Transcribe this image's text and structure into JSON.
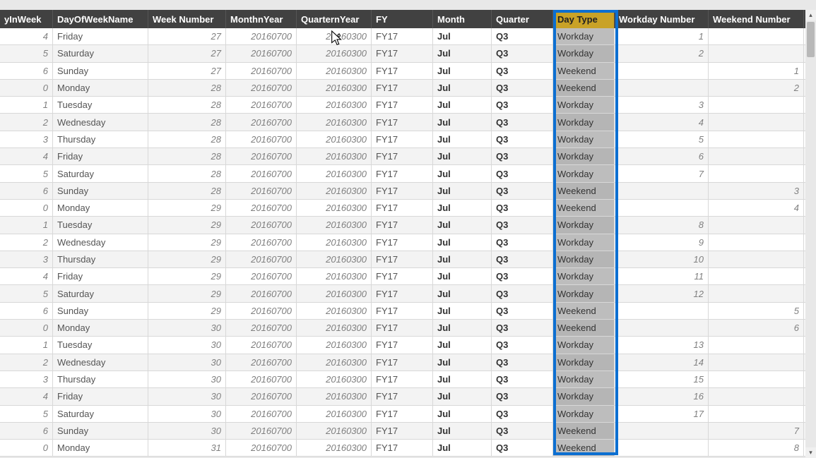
{
  "columns": [
    {
      "key": "dayInWeek",
      "label": "yInWeek"
    },
    {
      "key": "dayOfWeekName",
      "label": "DayOfWeekName"
    },
    {
      "key": "weekNumber",
      "label": "Week Number"
    },
    {
      "key": "monthnYear",
      "label": "MonthnYear"
    },
    {
      "key": "quarternYear",
      "label": "QuarternYear"
    },
    {
      "key": "fy",
      "label": "FY"
    },
    {
      "key": "month",
      "label": "Month"
    },
    {
      "key": "quarter",
      "label": "Quarter"
    },
    {
      "key": "dayType",
      "label": "Day Type"
    },
    {
      "key": "workdayNumber",
      "label": "Workday Number"
    },
    {
      "key": "weekendNumber",
      "label": "Weekend Number"
    }
  ],
  "highlighted_column_index": 8,
  "rows": [
    {
      "dayInWeek": "4",
      "dayOfWeekName": "Friday",
      "weekNumber": "27",
      "monthnYear": "20160700",
      "quarternYear": "20160300",
      "fy": "FY17",
      "month": "Jul",
      "quarter": "Q3",
      "dayType": "Workday",
      "workdayNumber": "1",
      "weekendNumber": ""
    },
    {
      "dayInWeek": "5",
      "dayOfWeekName": "Saturday",
      "weekNumber": "27",
      "monthnYear": "20160700",
      "quarternYear": "20160300",
      "fy": "FY17",
      "month": "Jul",
      "quarter": "Q3",
      "dayType": "Workday",
      "workdayNumber": "2",
      "weekendNumber": ""
    },
    {
      "dayInWeek": "6",
      "dayOfWeekName": "Sunday",
      "weekNumber": "27",
      "monthnYear": "20160700",
      "quarternYear": "20160300",
      "fy": "FY17",
      "month": "Jul",
      "quarter": "Q3",
      "dayType": "Weekend",
      "workdayNumber": "",
      "weekendNumber": "1"
    },
    {
      "dayInWeek": "0",
      "dayOfWeekName": "Monday",
      "weekNumber": "28",
      "monthnYear": "20160700",
      "quarternYear": "20160300",
      "fy": "FY17",
      "month": "Jul",
      "quarter": "Q3",
      "dayType": "Weekend",
      "workdayNumber": "",
      "weekendNumber": "2"
    },
    {
      "dayInWeek": "1",
      "dayOfWeekName": "Tuesday",
      "weekNumber": "28",
      "monthnYear": "20160700",
      "quarternYear": "20160300",
      "fy": "FY17",
      "month": "Jul",
      "quarter": "Q3",
      "dayType": "Workday",
      "workdayNumber": "3",
      "weekendNumber": ""
    },
    {
      "dayInWeek": "2",
      "dayOfWeekName": "Wednesday",
      "weekNumber": "28",
      "monthnYear": "20160700",
      "quarternYear": "20160300",
      "fy": "FY17",
      "month": "Jul",
      "quarter": "Q3",
      "dayType": "Workday",
      "workdayNumber": "4",
      "weekendNumber": ""
    },
    {
      "dayInWeek": "3",
      "dayOfWeekName": "Thursday",
      "weekNumber": "28",
      "monthnYear": "20160700",
      "quarternYear": "20160300",
      "fy": "FY17",
      "month": "Jul",
      "quarter": "Q3",
      "dayType": "Workday",
      "workdayNumber": "5",
      "weekendNumber": ""
    },
    {
      "dayInWeek": "4",
      "dayOfWeekName": "Friday",
      "weekNumber": "28",
      "monthnYear": "20160700",
      "quarternYear": "20160300",
      "fy": "FY17",
      "month": "Jul",
      "quarter": "Q3",
      "dayType": "Workday",
      "workdayNumber": "6",
      "weekendNumber": ""
    },
    {
      "dayInWeek": "5",
      "dayOfWeekName": "Saturday",
      "weekNumber": "28",
      "monthnYear": "20160700",
      "quarternYear": "20160300",
      "fy": "FY17",
      "month": "Jul",
      "quarter": "Q3",
      "dayType": "Workday",
      "workdayNumber": "7",
      "weekendNumber": ""
    },
    {
      "dayInWeek": "6",
      "dayOfWeekName": "Sunday",
      "weekNumber": "28",
      "monthnYear": "20160700",
      "quarternYear": "20160300",
      "fy": "FY17",
      "month": "Jul",
      "quarter": "Q3",
      "dayType": "Weekend",
      "workdayNumber": "",
      "weekendNumber": "3"
    },
    {
      "dayInWeek": "0",
      "dayOfWeekName": "Monday",
      "weekNumber": "29",
      "monthnYear": "20160700",
      "quarternYear": "20160300",
      "fy": "FY17",
      "month": "Jul",
      "quarter": "Q3",
      "dayType": "Weekend",
      "workdayNumber": "",
      "weekendNumber": "4"
    },
    {
      "dayInWeek": "1",
      "dayOfWeekName": "Tuesday",
      "weekNumber": "29",
      "monthnYear": "20160700",
      "quarternYear": "20160300",
      "fy": "FY17",
      "month": "Jul",
      "quarter": "Q3",
      "dayType": "Workday",
      "workdayNumber": "8",
      "weekendNumber": ""
    },
    {
      "dayInWeek": "2",
      "dayOfWeekName": "Wednesday",
      "weekNumber": "29",
      "monthnYear": "20160700",
      "quarternYear": "20160300",
      "fy": "FY17",
      "month": "Jul",
      "quarter": "Q3",
      "dayType": "Workday",
      "workdayNumber": "9",
      "weekendNumber": ""
    },
    {
      "dayInWeek": "3",
      "dayOfWeekName": "Thursday",
      "weekNumber": "29",
      "monthnYear": "20160700",
      "quarternYear": "20160300",
      "fy": "FY17",
      "month": "Jul",
      "quarter": "Q3",
      "dayType": "Workday",
      "workdayNumber": "10",
      "weekendNumber": ""
    },
    {
      "dayInWeek": "4",
      "dayOfWeekName": "Friday",
      "weekNumber": "29",
      "monthnYear": "20160700",
      "quarternYear": "20160300",
      "fy": "FY17",
      "month": "Jul",
      "quarter": "Q3",
      "dayType": "Workday",
      "workdayNumber": "11",
      "weekendNumber": ""
    },
    {
      "dayInWeek": "5",
      "dayOfWeekName": "Saturday",
      "weekNumber": "29",
      "monthnYear": "20160700",
      "quarternYear": "20160300",
      "fy": "FY17",
      "month": "Jul",
      "quarter": "Q3",
      "dayType": "Workday",
      "workdayNumber": "12",
      "weekendNumber": ""
    },
    {
      "dayInWeek": "6",
      "dayOfWeekName": "Sunday",
      "weekNumber": "29",
      "monthnYear": "20160700",
      "quarternYear": "20160300",
      "fy": "FY17",
      "month": "Jul",
      "quarter": "Q3",
      "dayType": "Weekend",
      "workdayNumber": "",
      "weekendNumber": "5"
    },
    {
      "dayInWeek": "0",
      "dayOfWeekName": "Monday",
      "weekNumber": "30",
      "monthnYear": "20160700",
      "quarternYear": "20160300",
      "fy": "FY17",
      "month": "Jul",
      "quarter": "Q3",
      "dayType": "Weekend",
      "workdayNumber": "",
      "weekendNumber": "6"
    },
    {
      "dayInWeek": "1",
      "dayOfWeekName": "Tuesday",
      "weekNumber": "30",
      "monthnYear": "20160700",
      "quarternYear": "20160300",
      "fy": "FY17",
      "month": "Jul",
      "quarter": "Q3",
      "dayType": "Workday",
      "workdayNumber": "13",
      "weekendNumber": ""
    },
    {
      "dayInWeek": "2",
      "dayOfWeekName": "Wednesday",
      "weekNumber": "30",
      "monthnYear": "20160700",
      "quarternYear": "20160300",
      "fy": "FY17",
      "month": "Jul",
      "quarter": "Q3",
      "dayType": "Workday",
      "workdayNumber": "14",
      "weekendNumber": ""
    },
    {
      "dayInWeek": "3",
      "dayOfWeekName": "Thursday",
      "weekNumber": "30",
      "monthnYear": "20160700",
      "quarternYear": "20160300",
      "fy": "FY17",
      "month": "Jul",
      "quarter": "Q3",
      "dayType": "Workday",
      "workdayNumber": "15",
      "weekendNumber": ""
    },
    {
      "dayInWeek": "4",
      "dayOfWeekName": "Friday",
      "weekNumber": "30",
      "monthnYear": "20160700",
      "quarternYear": "20160300",
      "fy": "FY17",
      "month": "Jul",
      "quarter": "Q3",
      "dayType": "Workday",
      "workdayNumber": "16",
      "weekendNumber": ""
    },
    {
      "dayInWeek": "5",
      "dayOfWeekName": "Saturday",
      "weekNumber": "30",
      "monthnYear": "20160700",
      "quarternYear": "20160300",
      "fy": "FY17",
      "month": "Jul",
      "quarter": "Q3",
      "dayType": "Workday",
      "workdayNumber": "17",
      "weekendNumber": ""
    },
    {
      "dayInWeek": "6",
      "dayOfWeekName": "Sunday",
      "weekNumber": "30",
      "monthnYear": "20160700",
      "quarternYear": "20160300",
      "fy": "FY17",
      "month": "Jul",
      "quarter": "Q3",
      "dayType": "Weekend",
      "workdayNumber": "",
      "weekendNumber": "7"
    },
    {
      "dayInWeek": "0",
      "dayOfWeekName": "Monday",
      "weekNumber": "31",
      "monthnYear": "20160700",
      "quarternYear": "20160300",
      "fy": "FY17",
      "month": "Jul",
      "quarter": "Q3",
      "dayType": "Weekend",
      "workdayNumber": "",
      "weekendNumber": "8"
    }
  ],
  "cursor_row_shown_value": "20160300"
}
